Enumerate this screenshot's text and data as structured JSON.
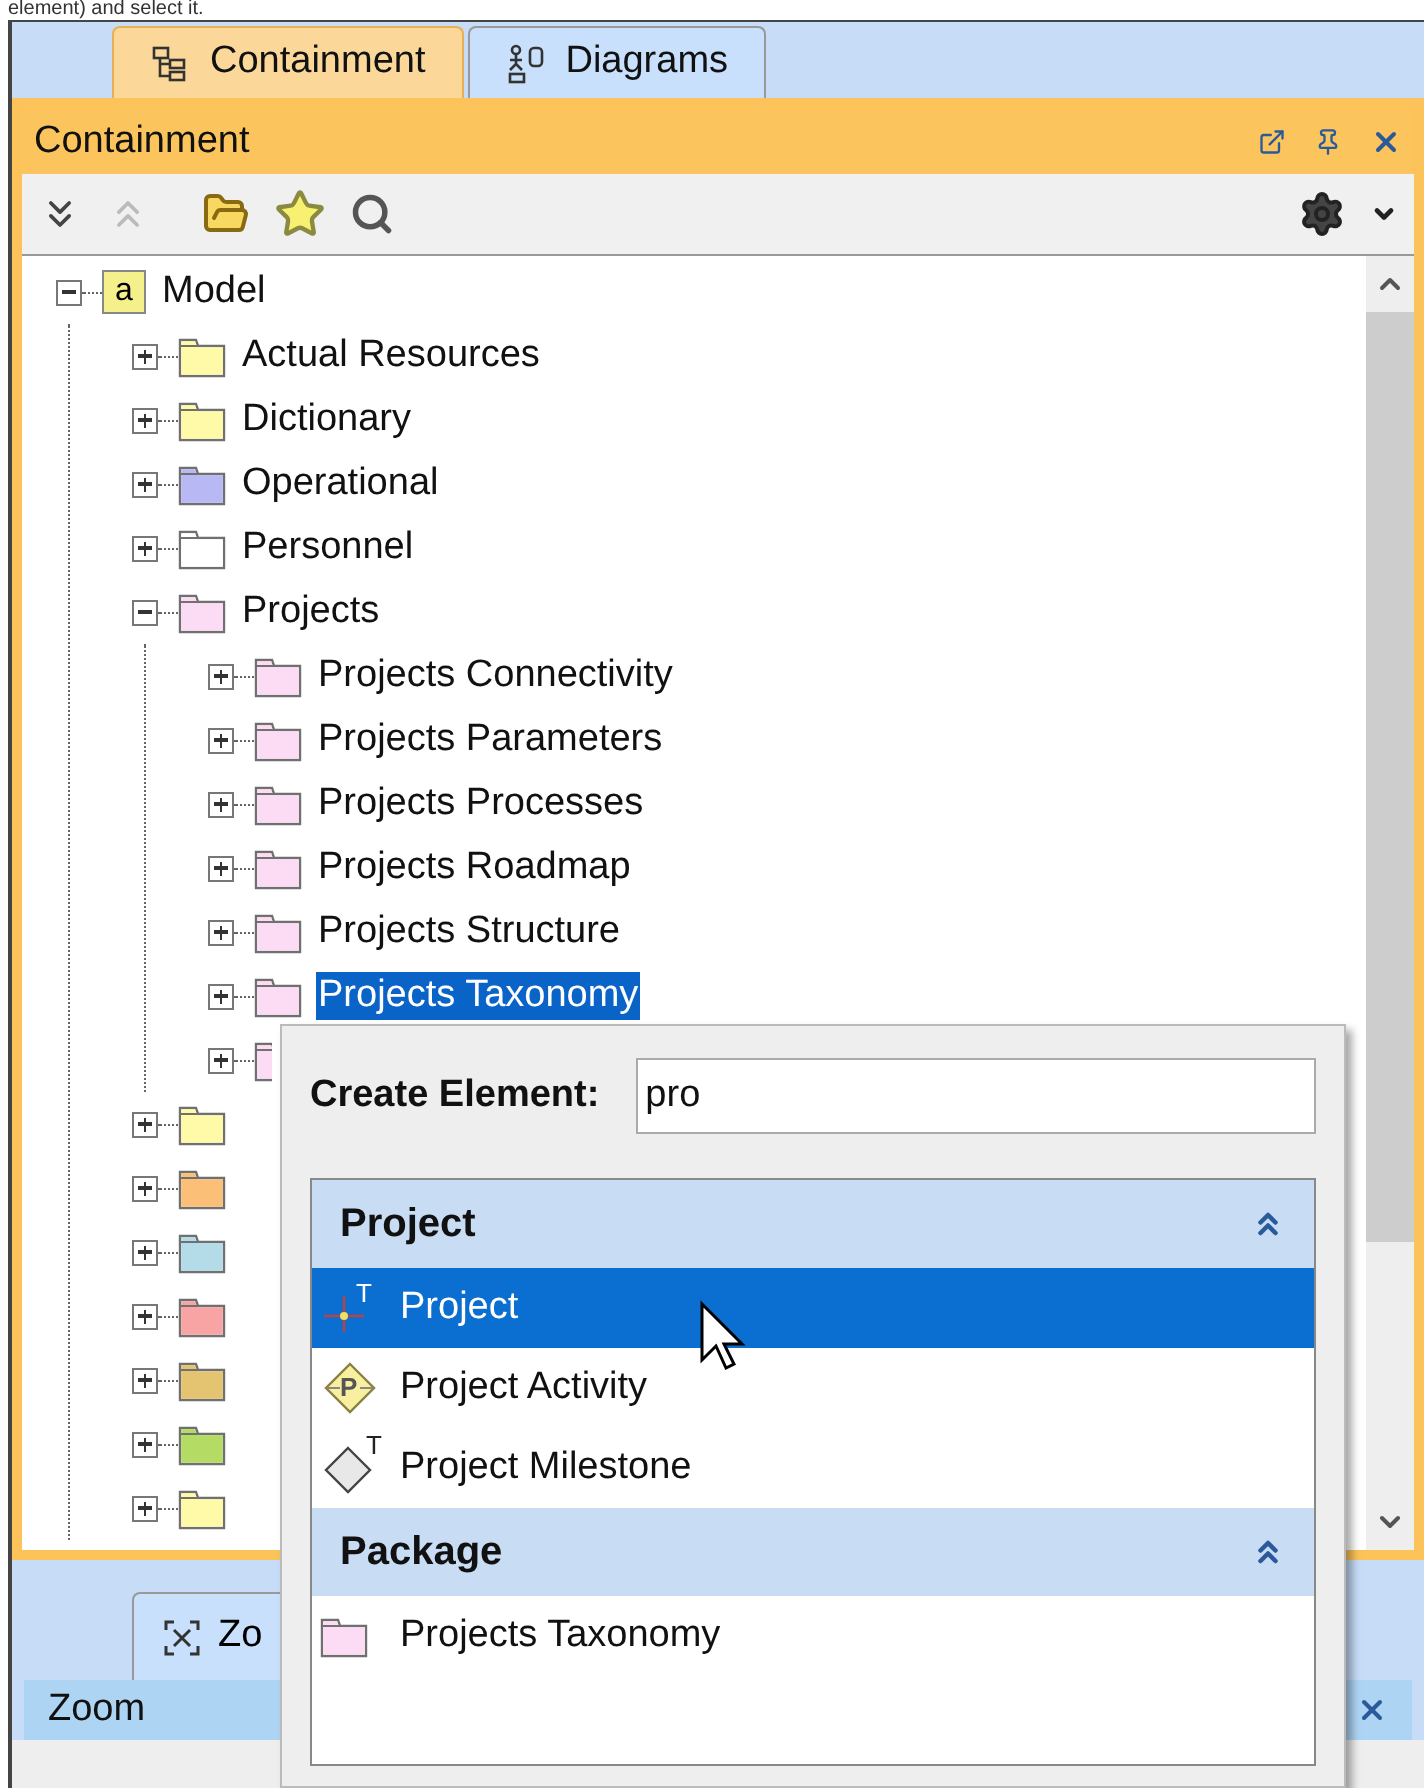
{
  "intro_text": "element) and select it.",
  "tabs": [
    {
      "label": "Containment",
      "selected": true,
      "kind": "containment"
    },
    {
      "label": "Diagrams",
      "selected": false,
      "kind": "diagrams"
    }
  ],
  "panel": {
    "title": "Containment"
  },
  "tree": [
    {
      "label": "Model",
      "kind": "model",
      "icon_letter": "a",
      "color": "#f4f08c",
      "expanded": true,
      "selected": false,
      "children": [
        {
          "label": "Actual Resources",
          "kind": "package",
          "color": "#fffaa8",
          "expanded": false,
          "selected": false
        },
        {
          "label": "Dictionary",
          "kind": "package",
          "color": "#fffaa8",
          "expanded": false,
          "selected": false
        },
        {
          "label": "Operational",
          "kind": "package",
          "color": "#b8b8f4",
          "expanded": false,
          "selected": false
        },
        {
          "label": "Personnel",
          "kind": "package",
          "color": "#ffffff",
          "expanded": false,
          "selected": false
        },
        {
          "label": "Projects",
          "kind": "package",
          "color": "#fcdcf4",
          "expanded": true,
          "selected": false,
          "children": [
            {
              "label": "Projects Connectivity",
              "kind": "package",
              "color": "#fcdcf4",
              "expanded": false,
              "selected": false
            },
            {
              "label": "Projects Parameters",
              "kind": "package",
              "color": "#fcdcf4",
              "expanded": false,
              "selected": false
            },
            {
              "label": "Projects Processes",
              "kind": "package",
              "color": "#fcdcf4",
              "expanded": false,
              "selected": false
            },
            {
              "label": "Projects Roadmap",
              "kind": "package",
              "color": "#fcdcf4",
              "expanded": false,
              "selected": false
            },
            {
              "label": "Projects Structure",
              "kind": "package",
              "color": "#fcdcf4",
              "expanded": false,
              "selected": false
            },
            {
              "label": "Projects Taxonomy",
              "kind": "package",
              "color": "#fcdcf4",
              "expanded": false,
              "selected": true
            },
            {
              "kind": "package",
              "color": "#fcdcf4",
              "expanded": false,
              "clipped": true
            }
          ]
        },
        {
          "kind": "package",
          "color": "#fffaa8",
          "expanded": false
        },
        {
          "kind": "package",
          "color": "#fbbf78",
          "expanded": false
        },
        {
          "kind": "package",
          "color": "#b4dce8",
          "expanded": false
        },
        {
          "kind": "package",
          "color": "#f8a4a4",
          "expanded": false
        },
        {
          "kind": "package",
          "color": "#e4c470",
          "expanded": false
        },
        {
          "kind": "package",
          "color": "#b4dc64",
          "expanded": false
        },
        {
          "kind": "package",
          "color": "#fffaa8",
          "expanded": false
        }
      ]
    }
  ],
  "popup": {
    "label": "Create Element:",
    "value": "pro",
    "groups": [
      {
        "title": "Project",
        "expanded": true,
        "items": [
          {
            "label": "Project",
            "kind": "project",
            "badge": "T",
            "selected": true
          },
          {
            "label": "Project Activity",
            "kind": "activity",
            "badge": "P",
            "selected": false
          },
          {
            "label": "Project Milestone",
            "kind": "milestone",
            "badge": "T",
            "selected": false
          }
        ]
      },
      {
        "title": "Package",
        "expanded": true,
        "items": [
          {
            "label": "Projects Taxonomy",
            "kind": "package",
            "color": "#fcdcf4",
            "selected": false
          }
        ]
      }
    ]
  },
  "bottom": {
    "tab": "Zo",
    "title": "Zoom"
  }
}
